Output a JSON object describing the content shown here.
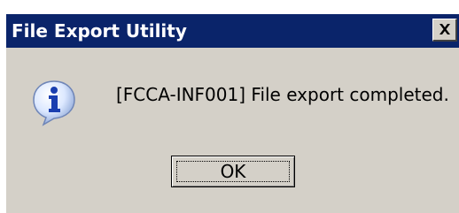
{
  "window": {
    "title": "File Export Utility"
  },
  "title_bar": {
    "close_icon": "close-icon"
  },
  "content": {
    "icon": "information-icon",
    "message": "[FCCA-INF001] File export completed."
  },
  "buttons": {
    "ok_label": "OK"
  },
  "colors": {
    "title_bar": "#0a246a",
    "dialog_face": "#d4d0c8"
  }
}
